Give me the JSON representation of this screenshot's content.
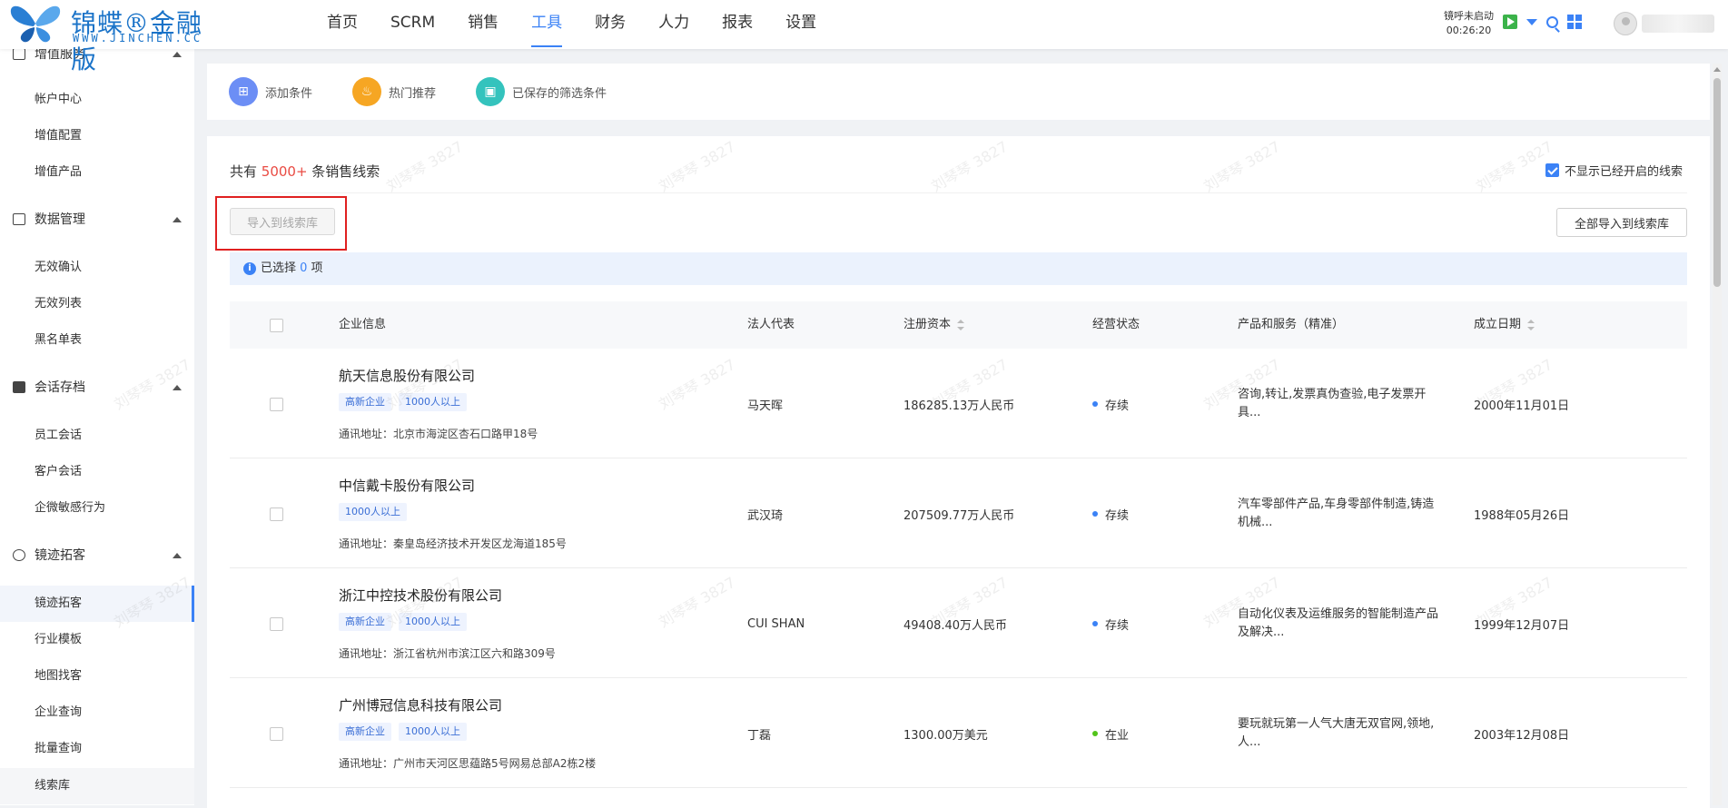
{
  "brand": {
    "cn": "锦蝶®金融版",
    "en": "WWW.JINCHEN.CC"
  },
  "nav": [
    "首页",
    "SCRM",
    "销售",
    "工具",
    "财务",
    "人力",
    "报表",
    "设置"
  ],
  "nav_active_index": 3,
  "call": {
    "status": "镜呼未启动",
    "time": "00:26:20"
  },
  "sidebar": {
    "g0": {
      "label": "增值服务",
      "icon": "gift-icon"
    },
    "g0_items": [
      "帐户中心",
      "增值配置",
      "增值产品"
    ],
    "g1": {
      "label": "数据管理",
      "icon": "data-icon"
    },
    "g1_items": [
      "无效确认",
      "无效列表",
      "黑名单表"
    ],
    "g2": {
      "label": "会话存档",
      "icon": "chat-archive-icon"
    },
    "g2_items": [
      "员工会话",
      "客户会话",
      "企微敏感行为"
    ],
    "g3": {
      "label": "镜迹拓客",
      "icon": "footprint-icon"
    },
    "g3_items": [
      "镜迹拓客",
      "行业模板",
      "地图找客",
      "企业查询",
      "批量查询",
      "线索库"
    ]
  },
  "filters": {
    "add": "添加条件",
    "hot": "热门推荐",
    "saved": "已保存的筛选条件"
  },
  "summary": {
    "prefix": "共有 ",
    "count": "5000+",
    "suffix": " 条销售线索"
  },
  "hide_opened_label": "不显示已经开启的线索",
  "hide_opened_checked": true,
  "import_btn": "导入到线索库",
  "import_all_btn": "全部导入到线索库",
  "selected": {
    "prefix": "已选择 ",
    "count": "0",
    "suffix": " 项"
  },
  "columns": {
    "company": "企业信息",
    "legal": "法人代表",
    "capital": "注册资本",
    "status": "经营状态",
    "product": "产品和服务（精准）",
    "date": "成立日期"
  },
  "rows": [
    {
      "name": "航天信息股份有限公司",
      "tags": [
        "高新企业",
        "1000人以上"
      ],
      "address": "通讯地址：北京市海淀区杏石口路甲18号",
      "legal": "马天晖",
      "capital": "186285.13万人民币",
      "status": "存续",
      "status_color": "#3b82f6",
      "product": "咨询,转让,发票真伪查验,电子发票开具...",
      "date": "2000年11月01日"
    },
    {
      "name": "中信戴卡股份有限公司",
      "tags": [
        "1000人以上"
      ],
      "address": "通讯地址：秦皇岛经济技术开发区龙海道185号",
      "legal": "武汉琦",
      "capital": "207509.77万人民币",
      "status": "存续",
      "status_color": "#3b82f6",
      "product": "汽车零部件产品,车身零部件制造,铸造机械...",
      "date": "1988年05月26日"
    },
    {
      "name": "浙江中控技术股份有限公司",
      "tags": [
        "高新企业",
        "1000人以上"
      ],
      "address": "通讯地址：浙江省杭州市滨江区六和路309号",
      "legal": "CUI SHAN",
      "capital": "49408.40万人民币",
      "status": "存续",
      "status_color": "#3b82f6",
      "product": "自动化仪表及运维服务的智能制造产品及解决...",
      "date": "1999年12月07日"
    },
    {
      "name": "广州博冠信息科技有限公司",
      "tags": [
        "高新企业",
        "1000人以上"
      ],
      "address": "通讯地址：广州市天河区思蕴路5号网易总部A2栋2楼",
      "legal": "丁磊",
      "capital": "1300.00万美元",
      "status": "在业",
      "status_color": "#52c41a",
      "product": "要玩就玩第一人气大唐无双官网,领地,人...",
      "date": "2003年12月08日"
    }
  ],
  "watermark": "刘琴琴 3827",
  "colors": {
    "accent": "#3b82f6",
    "highlight": "#e94b43",
    "add_icon_bg": "#6c8ef5",
    "hot_icon_bg": "#f6a623",
    "saved_icon_bg": "#34c3bd"
  }
}
